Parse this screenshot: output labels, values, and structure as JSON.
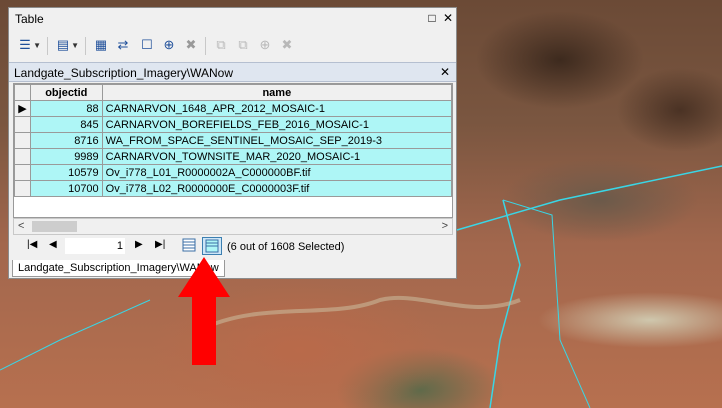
{
  "window": {
    "title": "Table",
    "restore_glyph": "□",
    "close_glyph": "✕"
  },
  "layer_header": {
    "title": "Landgate_Subscription_Imagery\\WANow",
    "close_glyph": "✕"
  },
  "table": {
    "columns": [
      "objectid",
      "name"
    ],
    "current_row_marker": "▶",
    "rows": [
      {
        "objectid": "88",
        "name": "CARNARVON_1648_APR_2012_MOSAIC-1"
      },
      {
        "objectid": "845",
        "name": "CARNARVON_BOREFIELDS_FEB_2016_MOSAIC-1"
      },
      {
        "objectid": "8716",
        "name": "WA_FROM_SPACE_SENTINEL_MOSAIC_SEP_2019-3"
      },
      {
        "objectid": "9989",
        "name": "CARNARVON_TOWNSITE_MAR_2020_MOSAIC-1"
      },
      {
        "objectid": "10579",
        "name": "Ov_i778_L01_R0000002A_C000000BF.tif"
      },
      {
        "objectid": "10700",
        "name": "Ov_i778_L02_R0000000E_C0000003F.tif"
      }
    ],
    "row_highlight_color": "#aef6f6"
  },
  "navigation": {
    "page_value": "1",
    "selection_status": "(6 out of 1608 Selected)"
  },
  "tabs": [
    "Landgate_Subscription_Imagery\\WANow"
  ],
  "annotation": {
    "arrow_color": "#ff0000"
  }
}
